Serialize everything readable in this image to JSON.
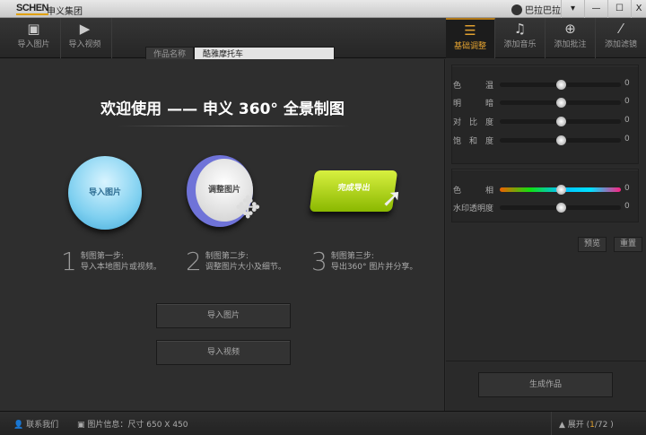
{
  "titlebar": {
    "logo": "SCHEN",
    "app_name": "申义集团",
    "user": "巴拉巴拉",
    "menu": "▾",
    "minimize": "—",
    "maximize": "☐",
    "close": "X"
  },
  "toolbar": {
    "import_image": "导入图片",
    "import_video": "导入视频",
    "name_label": "作品名称",
    "name_value": "酷雅摩托车",
    "tabs": [
      {
        "label": "基础调整",
        "active": true
      },
      {
        "label": "添加音乐"
      },
      {
        "label": "添加批注"
      },
      {
        "label": "添加滤镜"
      }
    ]
  },
  "main": {
    "welcome": "欢迎使用 —— 申义 360° 全景制图",
    "icons": {
      "import": "导入图片",
      "adjust": "调整图片",
      "export": "完成导出"
    },
    "steps": [
      {
        "num": "1",
        "title": "制图第一步:",
        "desc": "导入本地图片或视频。"
      },
      {
        "num": "2",
        "title": "制图第二步:",
        "desc": "调整图片大小及细节。"
      },
      {
        "num": "3",
        "title": "制图第三步:",
        "desc": "导出360° 图片并分享。"
      }
    ],
    "import_image_button": "导入图片",
    "import_video_button": "导入视频"
  },
  "adjust": {
    "sliders": [
      {
        "label": "色温",
        "value": "0",
        "level": 0.5
      },
      {
        "label": "明暗",
        "value": "0",
        "level": 0.5
      },
      {
        "label": "对比度",
        "value": "0",
        "level": 0.5
      },
      {
        "label": "饱和度",
        "value": "0",
        "level": 0.5
      }
    ],
    "sliders2": [
      {
        "label": "色相",
        "value": "0",
        "level": 0.5
      },
      {
        "label": "水印透明度",
        "value": "0",
        "level": 0.5
      }
    ],
    "preview": "预览",
    "reset": "重置",
    "generate": "生成作品"
  },
  "status": {
    "contact": "联系我们",
    "info": "图片信息：尺寸  650 X 450",
    "expand": "▲ 展开 (",
    "page_current": "1",
    "page_total": "/72 )"
  }
}
